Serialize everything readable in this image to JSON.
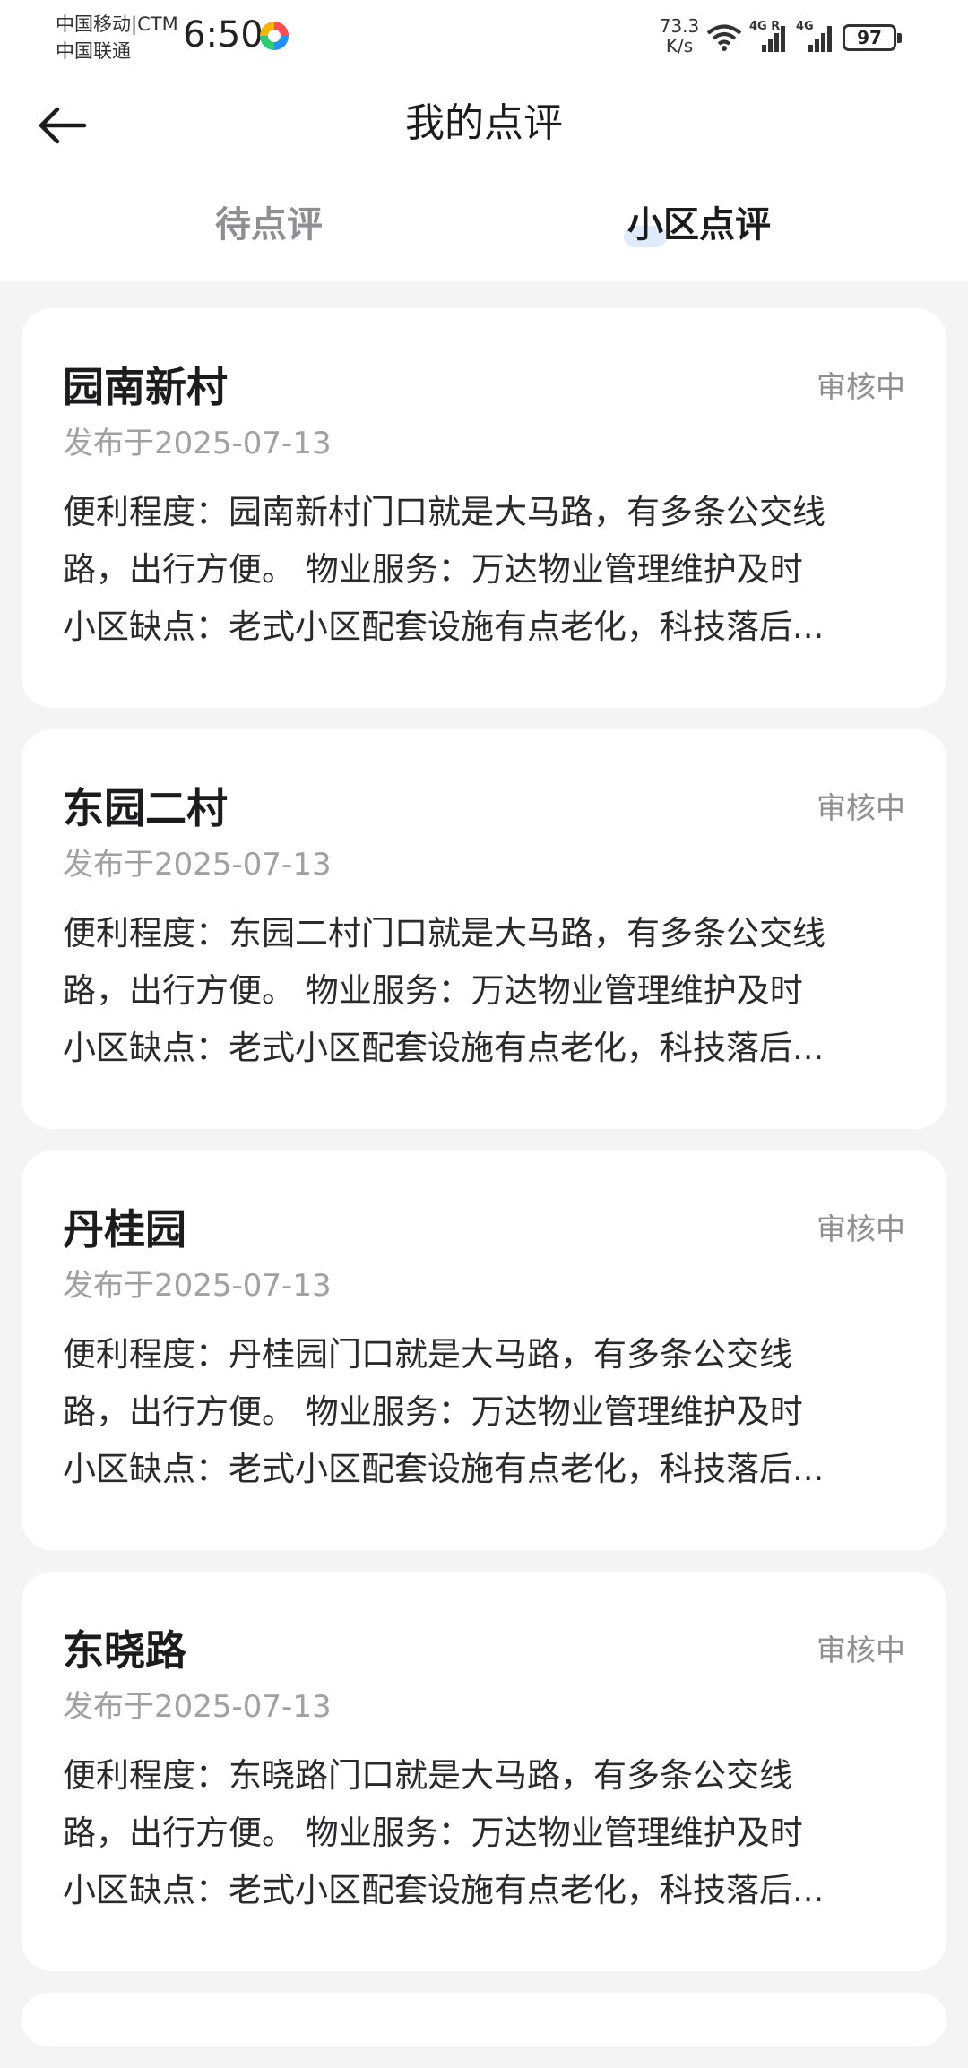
{
  "status_bar": {
    "carrier_1": "中国移动|CTM",
    "carrier_2": "中国联通",
    "time": "6:50",
    "net_speed_value": "73.3",
    "net_speed_unit": "K/s",
    "signal_1_label": "4G R",
    "signal_2_label": "4G",
    "battery": "97",
    "icons": [
      "wifi-icon",
      "signal-icon",
      "signal-icon",
      "battery-icon"
    ]
  },
  "header": {
    "title": "我的点评",
    "back_icon": "arrow-left-icon"
  },
  "tabs": [
    {
      "label": "待点评",
      "active": false
    },
    {
      "label": "小区点评",
      "active": true
    }
  ],
  "reviews": [
    {
      "name": "园南新村",
      "status": "审核中",
      "date": "发布于2025-07-13",
      "lines": [
        "便利程度：园南新村门口就是大马路，有多条公交线",
        "路，出行方便。 物业服务：万达物业管理维护及时",
        "小区缺点：老式小区配套设施有点老化，科技落后..."
      ]
    },
    {
      "name": "东园二村",
      "status": "审核中",
      "date": "发布于2025-07-13",
      "lines": [
        "便利程度：东园二村门口就是大马路，有多条公交线",
        "路，出行方便。 物业服务：万达物业管理维护及时",
        "小区缺点：老式小区配套设施有点老化，科技落后..."
      ]
    },
    {
      "name": "丹桂园",
      "status": "审核中",
      "date": "发布于2025-07-13",
      "lines": [
        "便利程度：丹桂园门口就是大马路，有多条公交线",
        "路，出行方便。 物业服务：万达物业管理维护及时",
        "小区缺点：老式小区配套设施有点老化，科技落后..."
      ]
    },
    {
      "name": "东晓路",
      "status": "审核中",
      "date": "发布于2025-07-13",
      "lines": [
        "便利程度：东晓路门口就是大马路，有多条公交线",
        "路，出行方便。 物业服务：万达物业管理维护及时",
        "小区缺点：老式小区配套设施有点老化，科技落后..."
      ]
    }
  ]
}
